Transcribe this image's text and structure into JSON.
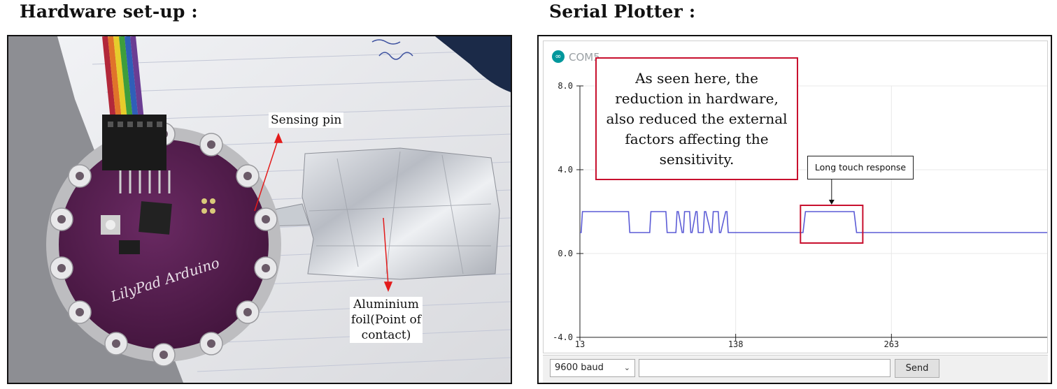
{
  "headings": {
    "left": "Hardware set-up :",
    "right": "Serial Plotter :"
  },
  "photo": {
    "sensing_label": "Sensing pin",
    "foil_label": "Aluminium foil(Point of contact)",
    "board_text": "LilyPad Arduino"
  },
  "plotter": {
    "port_title": "COM5",
    "note_text": "As seen here, the reduction in hardware, also reduced the external factors affecting the sensitivity.",
    "callout_text": "Long touch response",
    "baud": "9600 baud",
    "send_label": "Send",
    "send_input_value": "",
    "colors": {
      "signal": "#5b5bd6",
      "highlight": "#c8102e"
    }
  },
  "chart_data": {
    "type": "line",
    "y_ticks": [
      "8.0",
      "4.0",
      "0.0",
      "-4.0"
    ],
    "x_ticks": [
      "13",
      "138",
      "263"
    ],
    "ylim": [
      -4,
      8
    ],
    "xlim": [
      13,
      388
    ],
    "grid": true,
    "series": [
      {
        "x": [
          13,
          14,
          15,
          51,
          52,
          53,
          68,
          69,
          70,
          82,
          83,
          84,
          90,
          91,
          92,
          95,
          96,
          97,
          101,
          102,
          103,
          106,
          107,
          108,
          112,
          113,
          114,
          118,
          119,
          120,
          124,
          125,
          126,
          130,
          131,
          132,
          136,
          137,
          138,
          192,
          194,
          196,
          233,
          235,
          237,
          388
        ],
        "y": [
          1,
          1,
          2,
          2,
          2,
          1,
          1,
          1,
          2,
          2,
          1,
          1,
          1,
          2,
          2,
          1,
          1,
          2,
          2,
          1,
          1,
          2,
          2,
          1,
          1,
          2,
          2,
          1,
          1,
          2,
          2,
          1,
          1,
          2,
          2,
          1,
          1,
          1,
          1,
          1,
          2,
          2,
          2,
          1,
          1,
          1
        ]
      }
    ]
  }
}
